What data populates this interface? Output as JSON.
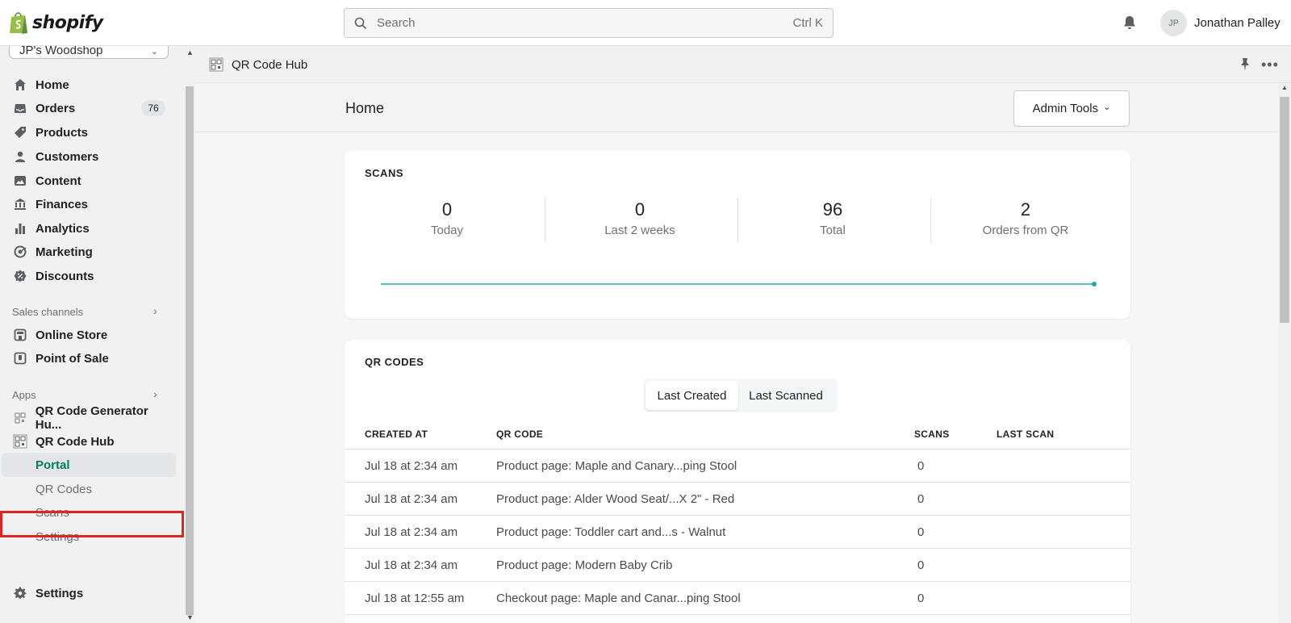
{
  "topbar": {
    "brand": "shopify",
    "search_placeholder": "Search",
    "search_shortcut": "Ctrl K",
    "avatar_initials": "JP",
    "username": "Jonathan Palley"
  },
  "sidebar": {
    "store_name": "JP's Woodshop",
    "nav": [
      {
        "label": "Home",
        "icon": "home-icon"
      },
      {
        "label": "Orders",
        "icon": "orders-icon",
        "badge": "76"
      },
      {
        "label": "Products",
        "icon": "tag-icon"
      },
      {
        "label": "Customers",
        "icon": "person-icon"
      },
      {
        "label": "Content",
        "icon": "content-icon"
      },
      {
        "label": "Finances",
        "icon": "bank-icon"
      },
      {
        "label": "Analytics",
        "icon": "bar-chart-icon"
      },
      {
        "label": "Marketing",
        "icon": "target-icon"
      },
      {
        "label": "Discounts",
        "icon": "discount-icon"
      }
    ],
    "sales_channels_label": "Sales channels",
    "sales_channels": [
      {
        "label": "Online Store",
        "icon": "store-icon"
      },
      {
        "label": "Point of Sale",
        "icon": "pos-icon"
      }
    ],
    "apps_label": "Apps",
    "apps": [
      {
        "label": "QR Code Generator Hu...",
        "icon": "qr-icon"
      },
      {
        "label": "QR Code Hub",
        "icon": "qr-hub-icon"
      }
    ],
    "app_sub": [
      "Portal",
      "QR Codes",
      "Scans",
      "Settings"
    ],
    "settings_label": "Settings"
  },
  "app_header": {
    "title": "QR Code Hub"
  },
  "page": {
    "title": "Home",
    "admin_tools_label": "Admin Tools"
  },
  "scans_card": {
    "title": "SCANS",
    "stats": [
      {
        "value": "0",
        "label": "Today"
      },
      {
        "value": "0",
        "label": "Last 2 weeks"
      },
      {
        "value": "96",
        "label": "Total"
      },
      {
        "value": "2",
        "label": "Orders from QR"
      }
    ]
  },
  "chart_data": {
    "type": "line",
    "series": [
      {
        "values": [
          0,
          0
        ]
      }
    ],
    "color": "#2ba3a3"
  },
  "qr_card": {
    "title": "QR CODES",
    "toggle": [
      "Last Created",
      "Last Scanned"
    ],
    "columns": [
      "CREATED AT",
      "QR CODE",
      "SCANS",
      "LAST SCAN"
    ],
    "rows": [
      {
        "created": "Jul 18 at 2:34 am",
        "code": "Product page: Maple and Canary...ping Stool",
        "scans": "0",
        "last": ""
      },
      {
        "created": "Jul 18 at 2:34 am",
        "code": "Product page: Alder Wood Seat/...X 2\" - Red",
        "scans": "0",
        "last": ""
      },
      {
        "created": "Jul 18 at 2:34 am",
        "code": "Product page: Toddler cart and...s - Walnut",
        "scans": "0",
        "last": ""
      },
      {
        "created": "Jul 18 at 2:34 am",
        "code": "Product page: Modern Baby Crib",
        "scans": "0",
        "last": ""
      },
      {
        "created": "Jul 18 at 12:55 am",
        "code": "Checkout page: Maple and Canar...ping Stool",
        "scans": "0",
        "last": ""
      }
    ]
  },
  "colors": {
    "accent_green": "#007f5f",
    "highlight_red": "#e02424",
    "chart_teal": "#2ba3a3"
  }
}
